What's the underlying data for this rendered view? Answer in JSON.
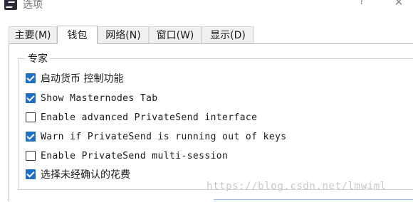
{
  "window": {
    "title": "选项",
    "help_glyph": "?",
    "close_glyph": "✕"
  },
  "tabs": [
    {
      "label": "主要(M)",
      "active": false
    },
    {
      "label": "钱包",
      "active": true
    },
    {
      "label": "网络(N)",
      "active": false
    },
    {
      "label": "窗口(W)",
      "active": false
    },
    {
      "label": "显示(D)",
      "active": false
    }
  ],
  "group": {
    "title": "专家"
  },
  "options": [
    {
      "label": "启动货币 控制功能",
      "checked": true
    },
    {
      "label": "Show Masternodes Tab",
      "checked": true
    },
    {
      "label": "Enable advanced PrivateSend interface",
      "checked": false
    },
    {
      "label": "Warn if PrivateSend is running out of keys",
      "checked": true
    },
    {
      "label": "Enable PrivateSend multi-session",
      "checked": false
    },
    {
      "label": "选择未经确认的花费",
      "checked": true
    }
  ],
  "watermark": "https://blog.csdn.net/lmwiml",
  "colors": {
    "checkbox_checked": "#1f6fc5",
    "border": "#bdbdbd",
    "tab_inactive_bg": "#f0f0f0"
  }
}
